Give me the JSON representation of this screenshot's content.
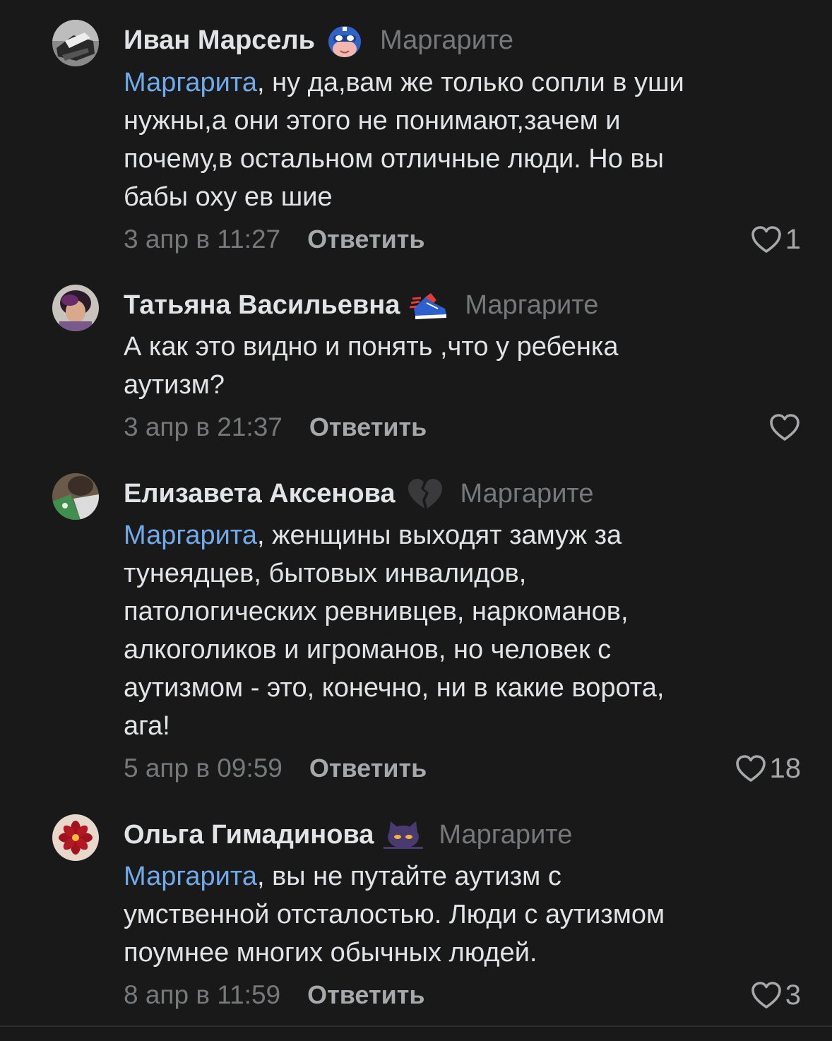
{
  "comments": [
    {
      "author": "Иван Марсель",
      "emoji_icon": "masked-hero-emoji",
      "reply_to": "Маргарите",
      "mention": "Маргарита",
      "lines": [
        ", ну да,вам же только сопли в уши",
        "нужны,а они этого не понимают,зачем и",
        "почему,в остальном отличные люди. Но вы",
        "бабы оху ев шие"
      ],
      "date": "3 апр в 11:27",
      "reply_label": "Ответить",
      "likes": "1"
    },
    {
      "author": "Татьяна Васильевна",
      "emoji_icon": "sneaker-emoji",
      "reply_to": "Маргарите",
      "mention": "",
      "lines": [
        "А как это видно и понять ,что у ребенка",
        "аутизм?"
      ],
      "date": "3 апр в 21:37",
      "reply_label": "Ответить",
      "likes": ""
    },
    {
      "author": "Елизавета Аксенова",
      "emoji_icon": "broken-heart-emoji",
      "reply_to": "Маргарите",
      "mention": "Маргарита",
      "lines": [
        ", женщины выходят замуж за",
        "тунеядцев, бытовых инвалидов,",
        "патологических ревнивцев, наркоманов,",
        "алкоголиков и игроманов, но человек с",
        "аутизмом - это, конечно, ни в какие ворота,",
        "ага!"
      ],
      "date": "5 апр в 09:59",
      "reply_label": "Ответить",
      "likes": "18"
    },
    {
      "author": "Ольга Гимадинова",
      "emoji_icon": "cat-face-emoji",
      "reply_to": "Маргарите",
      "mention": "Маргарита",
      "lines": [
        ", вы не путайте аутизм с",
        "умственной отсталостью. Люди с аутизмом",
        "поумнее многих обычных людей."
      ],
      "date": "8 апр в 11:59",
      "reply_label": "Ответить",
      "likes": "3"
    }
  ],
  "colors": {
    "background": "#19191a",
    "text": "#e1e3e6",
    "secondary": "#76787a",
    "mention": "#71aaeb"
  }
}
